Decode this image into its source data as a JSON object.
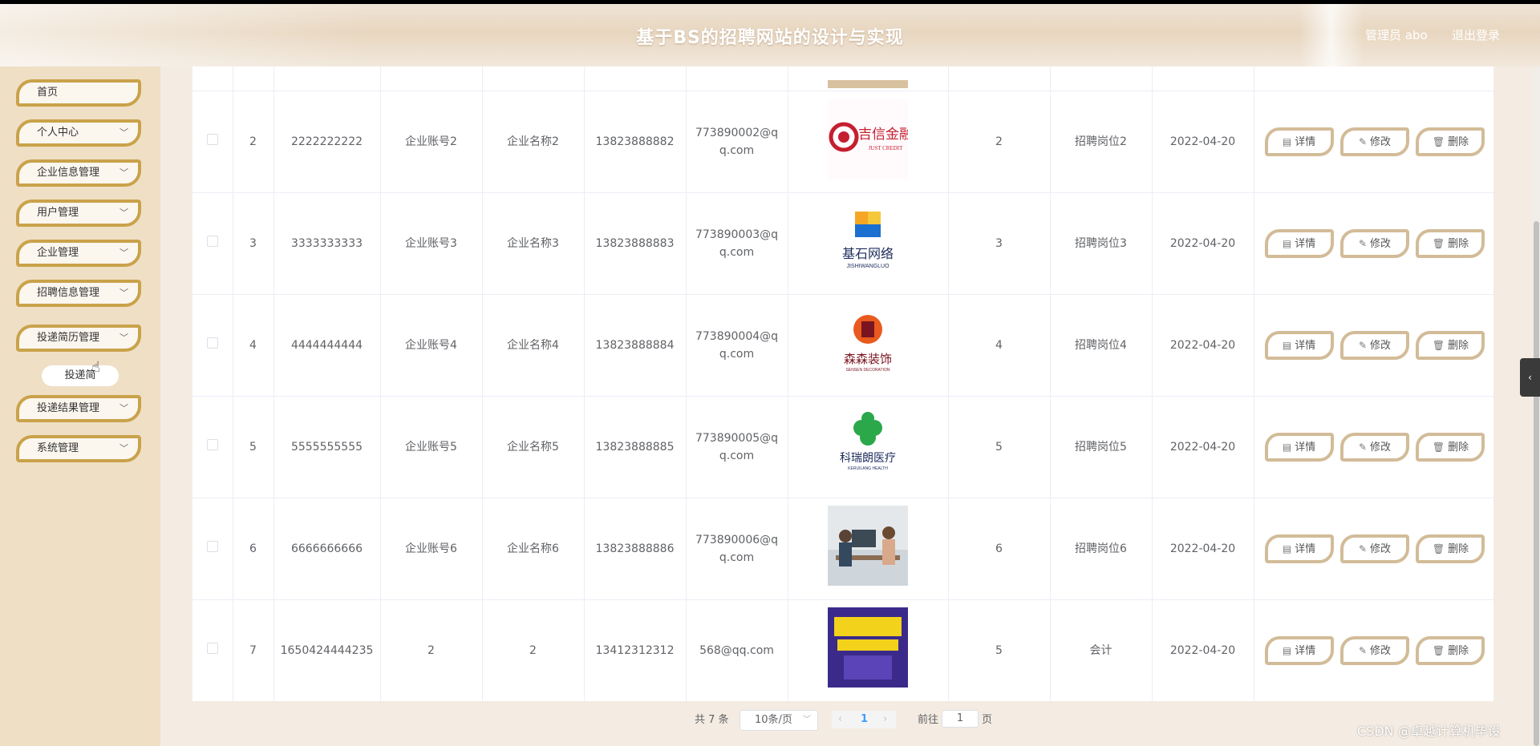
{
  "header": {
    "title": "基于BS的招聘网站的设计与实现",
    "user_label": "管理员 abo",
    "logout_label": "退出登录"
  },
  "sidebar": {
    "items": [
      {
        "label": "首页",
        "expandable": false
      },
      {
        "label": "个人中心",
        "expandable": true
      },
      {
        "label": "企业信息管理",
        "expandable": true
      },
      {
        "label": "用户管理",
        "expandable": true
      },
      {
        "label": "企业管理",
        "expandable": true
      },
      {
        "label": "招聘信息管理",
        "expandable": true
      },
      {
        "label": "投递简历管理",
        "expandable": true
      },
      {
        "label": "投递结果管理",
        "expandable": true
      },
      {
        "label": "系统管理",
        "expandable": true
      }
    ],
    "submenu_label": "投递简"
  },
  "table": {
    "actions": {
      "detail": "详情",
      "edit": "修改",
      "delete": "删除"
    },
    "rows": [
      {
        "index": "2",
        "number": "2222222222",
        "account": "企业账号2",
        "name": "企业名称2",
        "phone": "13823888882",
        "email": "773890002@qq.com",
        "logo_text": "吉信金融",
        "logo_sub": "JUST CREDIT",
        "count": "2",
        "position": "招聘岗位2",
        "date": "2022-04-20"
      },
      {
        "index": "3",
        "number": "3333333333",
        "account": "企业账号3",
        "name": "企业名称3",
        "phone": "13823888883",
        "email": "773890003@qq.com",
        "logo_text": "基石网络",
        "logo_sub": "JISHIWANGLUO",
        "count": "3",
        "position": "招聘岗位3",
        "date": "2022-04-20"
      },
      {
        "index": "4",
        "number": "4444444444",
        "account": "企业账号4",
        "name": "企业名称4",
        "phone": "13823888884",
        "email": "773890004@qq.com",
        "logo_text": "森森装饰",
        "logo_sub": "SENSEN DECORATION",
        "count": "4",
        "position": "招聘岗位4",
        "date": "2022-04-20"
      },
      {
        "index": "5",
        "number": "5555555555",
        "account": "企业账号5",
        "name": "企业名称5",
        "phone": "13823888885",
        "email": "773890005@qq.com",
        "logo_text": "科瑞朗医疗",
        "logo_sub": "KERUILANG HEALTH",
        "count": "5",
        "position": "招聘岗位5",
        "date": "2022-04-20"
      },
      {
        "index": "6",
        "number": "6666666666",
        "account": "企业账号6",
        "name": "企业名称6",
        "phone": "13823888886",
        "email": "773890006@qq.com",
        "logo_text": "",
        "logo_sub": "",
        "count": "6",
        "position": "招聘岗位6",
        "date": "2022-04-20"
      },
      {
        "index": "7",
        "number": "1650424444235",
        "account": "2",
        "name": "2",
        "phone": "13412312312",
        "email": "568@qq.com",
        "logo_text": "",
        "logo_sub": "",
        "count": "5",
        "position": "会计",
        "date": "2022-04-20"
      }
    ]
  },
  "pagination": {
    "total_label": "共 7 条",
    "page_size": "10条/页",
    "current_page": "1",
    "goto_label": "前往",
    "goto_value": "1",
    "page_unit": "页"
  },
  "watermark": "CSDN @卓越计算机毕设"
}
